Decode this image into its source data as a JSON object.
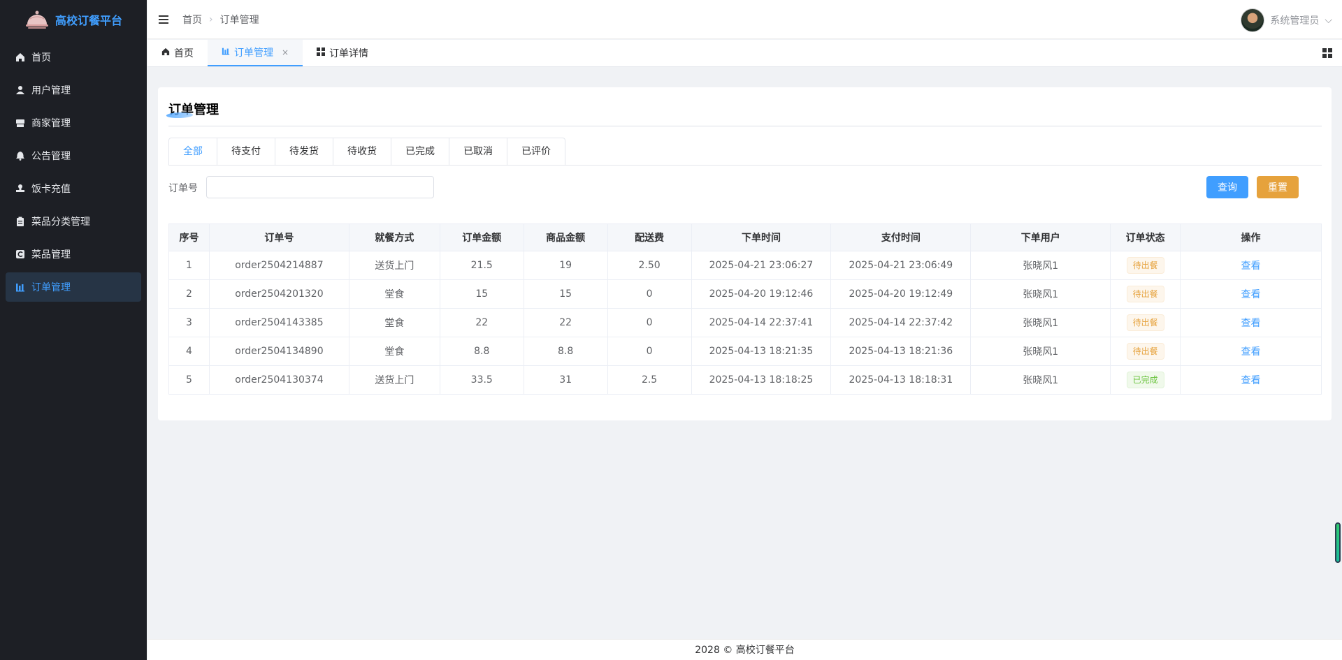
{
  "app": {
    "name": "高校订餐平台"
  },
  "sidebar": {
    "items": [
      {
        "label": "首页",
        "icon": "home-icon",
        "active": false
      },
      {
        "label": "用户管理",
        "icon": "user-icon",
        "active": false
      },
      {
        "label": "商家管理",
        "icon": "shop-icon",
        "active": false
      },
      {
        "label": "公告管理",
        "icon": "bell-icon",
        "active": false
      },
      {
        "label": "饭卡充值",
        "icon": "stamp-icon",
        "active": false
      },
      {
        "label": "菜品分类管理",
        "icon": "clipboard-icon",
        "active": false
      },
      {
        "label": "菜品管理",
        "icon": "dish-icon",
        "active": false
      },
      {
        "label": "订单管理",
        "icon": "bar-chart-icon",
        "active": true
      }
    ]
  },
  "header": {
    "breadcrumb": [
      "首页",
      "订单管理"
    ],
    "user_name": "系统管理员"
  },
  "tabs": [
    {
      "label": "首页",
      "icon": "home-icon"
    },
    {
      "label": "订单管理",
      "icon": "bar-chart-icon",
      "close": "×"
    },
    {
      "label": "订单详情",
      "icon": "grid-icon"
    }
  ],
  "page": {
    "title": "订单管理",
    "status_tabs": [
      "全部",
      "待支付",
      "待发货",
      "待收货",
      "已完成",
      "已取消",
      "已评价"
    ],
    "search": {
      "label": "订单号",
      "value": "",
      "placeholder": ""
    },
    "query_label": "查询",
    "reset_label": "重置"
  },
  "table": {
    "headers": [
      "序号",
      "订单号",
      "就餐方式",
      "订单金额",
      "商品金额",
      "配送费",
      "下单时间",
      "支付时间",
      "下单用户",
      "订单状态",
      "操作"
    ],
    "rows": [
      [
        "1",
        "order2504214887",
        "送货上门",
        "21.5",
        "19",
        "2.50",
        "2025-04-21 23:06:27",
        "2025-04-21 23:06:49",
        "张晓风1",
        "待出餐",
        "查看"
      ],
      [
        "2",
        "order2504201320",
        "堂食",
        "15",
        "15",
        "0",
        "2025-04-20 19:12:46",
        "2025-04-20 19:12:49",
        "张晓风1",
        "待出餐",
        "查看"
      ],
      [
        "3",
        "order2504143385",
        "堂食",
        "22",
        "22",
        "0",
        "2025-04-14 22:37:41",
        "2025-04-14 22:37:42",
        "张晓风1",
        "待出餐",
        "查看"
      ],
      [
        "4",
        "order2504134890",
        "堂食",
        "8.8",
        "8.8",
        "0",
        "2025-04-13 18:21:35",
        "2025-04-13 18:21:36",
        "张晓风1",
        "待出餐",
        "查看"
      ],
      [
        "5",
        "order2504130374",
        "送货上门",
        "33.5",
        "31",
        "2.5",
        "2025-04-13 18:18:25",
        "2025-04-13 18:18:31",
        "张晓风1",
        "已完成",
        "查看"
      ]
    ]
  },
  "footer": {
    "text": "2028 © 高校订餐平台"
  },
  "colors": {
    "primary": "#409eff",
    "warning": "#e6a23c",
    "success": "#67c23a",
    "sidebar_bg": "#1d1f25"
  }
}
